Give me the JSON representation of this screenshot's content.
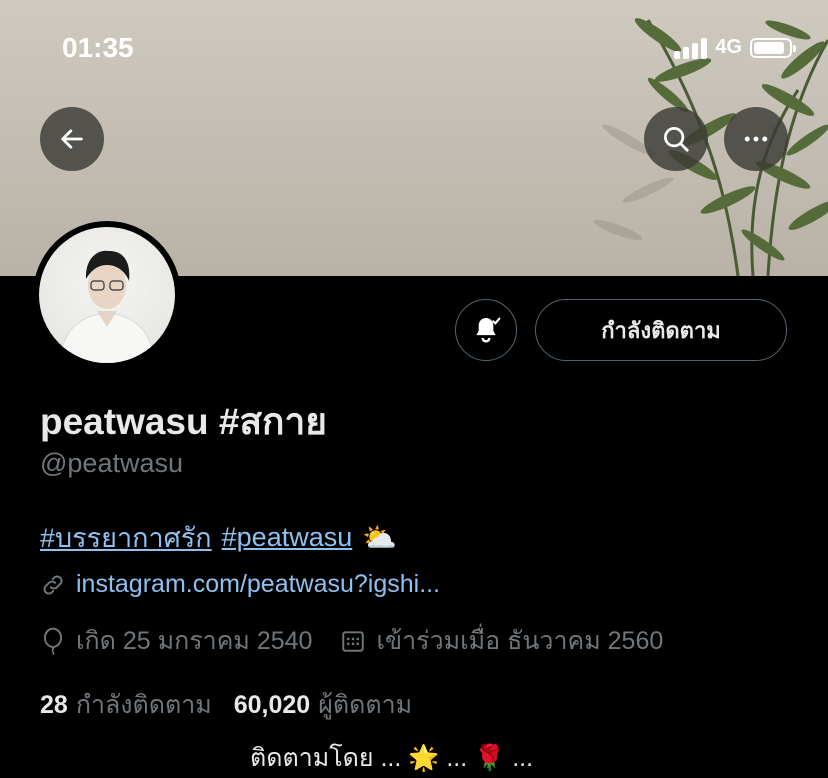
{
  "status_bar": {
    "time": "01:35",
    "network": "4G",
    "battery_level": 0.8,
    "signal_bars": 4
  },
  "header": {
    "back_icon": "arrow-left-icon",
    "search_icon": "search-icon",
    "more_icon": "more-horizontal-icon"
  },
  "profile": {
    "display_name": "peatwasu #สกาย",
    "handle": "@peatwasu",
    "bio": {
      "hashtag_1": "#บรรยากาศรัก",
      "hashtag_2": "#peatwasu",
      "emoji": "⛅"
    },
    "link": "instagram.com/peatwasu?igshi...",
    "birth": "เกิด 25 มกราคม 2540",
    "joined": "เข้าร่วมเมื่อ ธันวาคม 2560",
    "following_count": "28",
    "following_label": "กำลังติดตาม",
    "followers_count": "60,020",
    "followers_label": "ผู้ติดตาม",
    "cut_off_text": "ติดตามโดย ... 🌟 ... 🌹 ..."
  },
  "actions": {
    "follow_button_label": "กำลังติดตาม",
    "notification_icon": "bell-check-icon"
  },
  "colors": {
    "background": "#000000",
    "link": "#8fc1f0",
    "secondary_text": "#71767b",
    "border": "#536471"
  }
}
